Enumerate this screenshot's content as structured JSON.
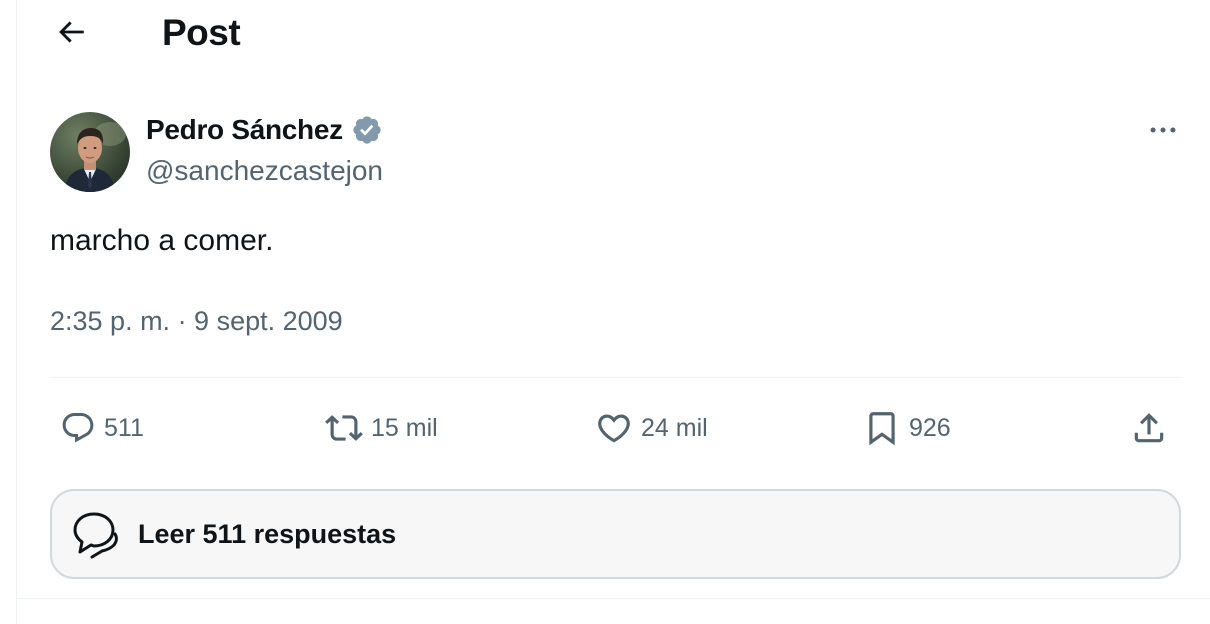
{
  "header": {
    "title": "Post",
    "back_icon": "arrow-left-icon"
  },
  "post": {
    "author": {
      "name": "Pedro Sánchez",
      "handle": "@sanchezcastejon",
      "verified": true,
      "verified_badge_color": "#829aab"
    },
    "text": "marcho a comer.",
    "timestamp": "2:35 p. m. · 9 sept. 2009",
    "more_icon": "ellipsis-icon"
  },
  "actions": {
    "replies": {
      "count": "511",
      "icon": "reply-icon"
    },
    "reposts": {
      "count": "15 mil",
      "icon": "repost-icon"
    },
    "likes": {
      "count": "24 mil",
      "icon": "heart-icon"
    },
    "bookmarks": {
      "count": "926",
      "icon": "bookmark-icon"
    },
    "share": {
      "icon": "share-icon"
    }
  },
  "read_replies": {
    "label": "Leer 511 respuestas",
    "icon": "conversation-icon"
  },
  "colors": {
    "text_primary": "#0f1419",
    "text_secondary": "#536471",
    "border": "#cfd9de",
    "divider": "#eff3f4"
  }
}
